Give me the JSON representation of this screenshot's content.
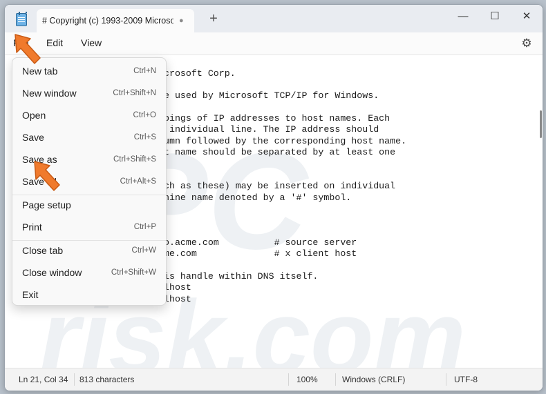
{
  "window": {
    "tab_title": "# Copyright (c) 1993-2009 Microso",
    "tab_status": "●",
    "new_tab_glyph": "+",
    "minimize_glyph": "—",
    "maximize_glyph": "☐",
    "close_glyph": "✕"
  },
  "menubar": {
    "file": "File",
    "edit": "Edit",
    "view": "View"
  },
  "file_menu": {
    "items": [
      {
        "label": "New tab",
        "shortcut": "Ctrl+N"
      },
      {
        "label": "New window",
        "shortcut": "Ctrl+Shift+N"
      },
      {
        "label": "Open",
        "shortcut": "Ctrl+O"
      },
      {
        "label": "Save",
        "shortcut": "Ctrl+S"
      },
      {
        "label": "Save as",
        "shortcut": "Ctrl+Shift+S"
      },
      {
        "label": "Save all",
        "shortcut": "Ctrl+Alt+S"
      },
      {
        "label": "Page setup",
        "shortcut": ""
      },
      {
        "label": "Print",
        "shortcut": "Ctrl+P"
      },
      {
        "label": "Close tab",
        "shortcut": "Ctrl+W"
      },
      {
        "label": "Close window",
        "shortcut": "Ctrl+Shift+W"
      },
      {
        "label": "Exit",
        "shortcut": ""
      }
    ]
  },
  "editor": {
    "lines": [
      "icrosoft Corp.",
      "le used by Microsoft TCP/IP for Windows.",
      "ppings of IP addresses to host names. Each",
      "n individual line. The IP address should",
      "lumn followed by the corresponding host name.",
      "st name should be separated by at least one",
      "uch as these) may be inserted on individual",
      "chine name denoted by a '#' symbol.",
      "no.acme.com          # source server",
      "cme.com              # x client host",
      " is handle within DNS itself.",
      "alhost",
      "alhost"
    ]
  },
  "statusbar": {
    "position": "Ln 21, Col 34",
    "characters": "813 characters",
    "zoom": "100%",
    "line_ending": "Windows (CRLF)",
    "encoding": "UTF-8"
  },
  "colors": {
    "arrow": "#f07a2c",
    "watermark": "#e9edf1"
  },
  "icons": {
    "app": "notepad-icon",
    "settings": "gear-icon"
  }
}
